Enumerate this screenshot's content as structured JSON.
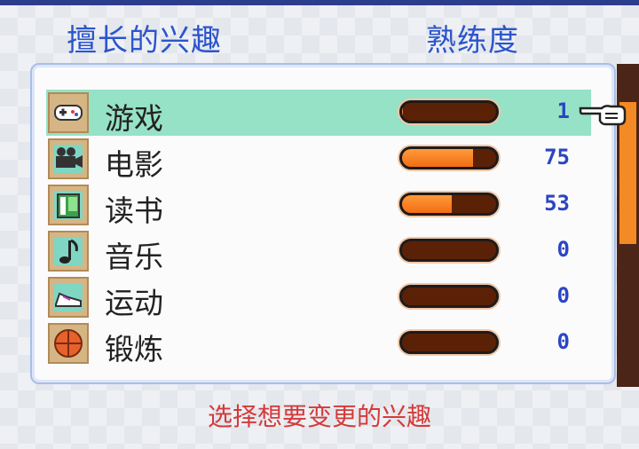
{
  "header": {
    "hobby_title": "擅长的兴趣",
    "proficiency_title": "熟练度"
  },
  "hobbies": [
    {
      "label": "游戏",
      "value": "1",
      "level": 0.01,
      "icon": "gamepad-icon",
      "selected": true
    },
    {
      "label": "电影",
      "value": "75",
      "level": 0.75,
      "icon": "movie-camera-icon",
      "selected": false
    },
    {
      "label": "读书",
      "value": "53",
      "level": 0.53,
      "icon": "book-icon",
      "selected": false
    },
    {
      "label": "音乐",
      "value": "0",
      "level": 0,
      "icon": "music-note-icon",
      "selected": false
    },
    {
      "label": "运动",
      "value": "0",
      "level": 0,
      "icon": "sneaker-icon",
      "selected": false
    },
    {
      "label": "锻炼",
      "value": "0",
      "level": 0,
      "icon": "ball-icon",
      "selected": false
    }
  ],
  "footer": {
    "instruction": "选择想要变更的兴趣"
  },
  "colors": {
    "header_text": "#2c55cc",
    "selected_row": "#96e2c6",
    "bar_fill": "#f26d14",
    "bar_empty": "#5b2106",
    "number_text": "#2b45c2",
    "footer_text": "#d43a3a"
  }
}
